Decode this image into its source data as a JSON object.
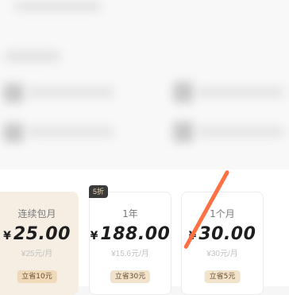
{
  "plans": [
    {
      "title": "连续包月",
      "currency": "¥",
      "price": "25.00",
      "unit_price": "¥25元/月",
      "save": "立省10元",
      "selected": true
    },
    {
      "title": "1年",
      "currency": "¥",
      "price": "188.00",
      "unit_price": "¥15.6元/月",
      "save": "立省30元",
      "selected": false,
      "tag": "5折"
    },
    {
      "title": "1个月",
      "currency": "¥",
      "price": "30.00",
      "unit_price": "¥30元/月",
      "save": "立省5元",
      "selected": false,
      "crossed_out": true
    }
  ],
  "colors": {
    "selected_card": "#f6eee3",
    "badge": "#f1e2cc",
    "tag_bg": "#3b3b3b",
    "slash": "#ff7043"
  }
}
